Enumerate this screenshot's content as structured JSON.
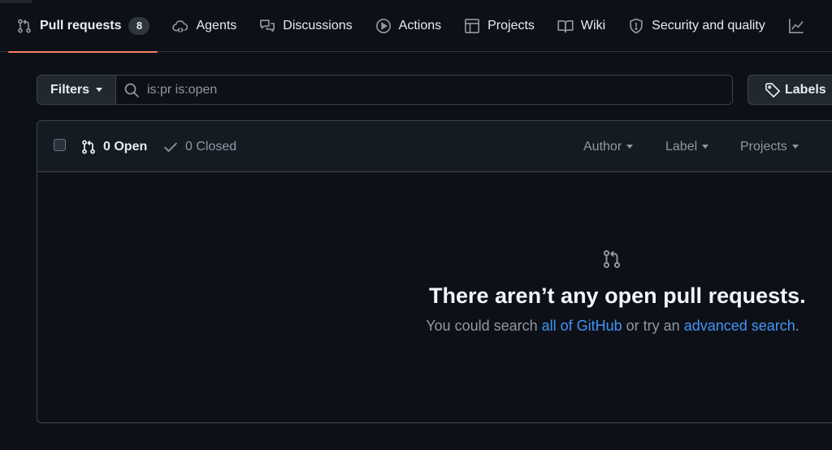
{
  "nav": {
    "tabs": [
      {
        "label": "Pull requests",
        "icon": "git-pull-request-icon",
        "counter": "8",
        "active": true
      },
      {
        "label": "Agents",
        "icon": "cloud-agent-icon"
      },
      {
        "label": "Discussions",
        "icon": "comment-discussion-icon"
      },
      {
        "label": "Actions",
        "icon": "play-icon"
      },
      {
        "label": "Projects",
        "icon": "table-icon"
      },
      {
        "label": "Wiki",
        "icon": "book-icon"
      },
      {
        "label": "Security and quality",
        "icon": "shield-icon"
      }
    ]
  },
  "filters": {
    "button_label": "Filters",
    "query": "is:pr is:open",
    "labels_button": "Labels"
  },
  "list": {
    "open_label": "0 Open",
    "closed_label": "0 Closed",
    "sorts": [
      "Author",
      "Label",
      "Projects"
    ]
  },
  "blankslate": {
    "title": "There aren’t any open pull requests.",
    "desc_prefix": "You could search ",
    "link_github": "all of GitHub",
    "desc_middle": " or try an ",
    "link_advanced": "advanced search",
    "desc_suffix": "."
  },
  "colors": {
    "background": "#0d1117",
    "tab_underline": "#f78166",
    "link": "#4493f8",
    "border": "#3d444d"
  }
}
